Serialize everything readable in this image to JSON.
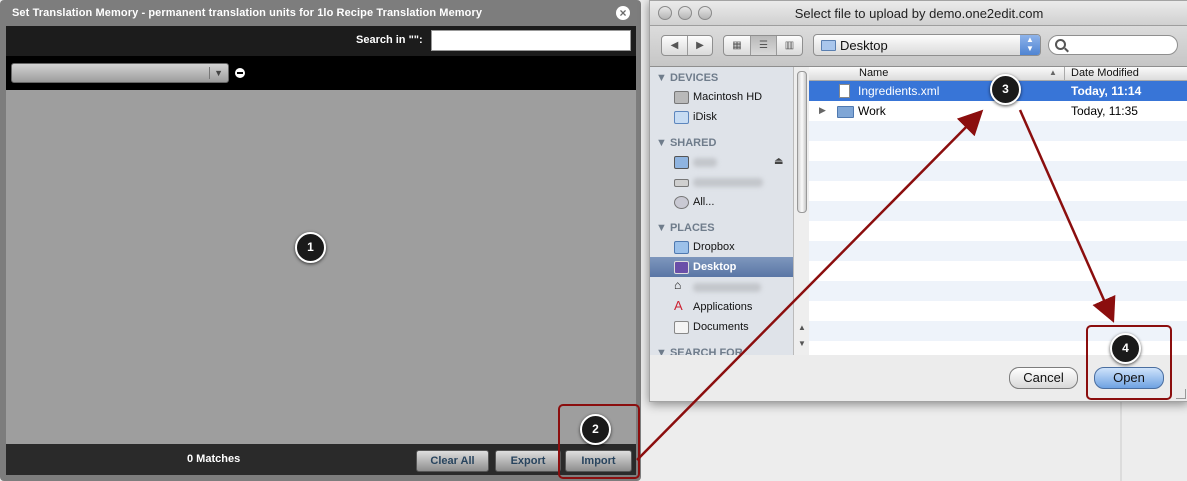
{
  "tm_dialog": {
    "title": "Set Translation Memory - permanent translation units for 1lo Recipe Translation Memory",
    "close_icon": "close-icon",
    "search_label": "Search in \"\":",
    "search_value": "",
    "filter_value": "",
    "matches_text": "0 Matches",
    "buttons": {
      "clear_all": "Clear All",
      "export": "Export",
      "import": "Import"
    }
  },
  "file_dialog": {
    "title": "Select file to upload by demo.one2edit.com",
    "location": "Desktop",
    "search_placeholder": "",
    "sidebar": {
      "devices_header": "DEVICES",
      "devices": [
        {
          "label": "Macintosh HD",
          "icon": "harddisk-icon"
        },
        {
          "label": "iDisk",
          "icon": "idisk-icon"
        }
      ],
      "shared_header": "SHARED",
      "shared": [
        {
          "label": "All...",
          "icon": "network-icon"
        }
      ],
      "places_header": "PLACES",
      "places": [
        {
          "label": "Dropbox",
          "icon": "dropbox-folder-icon"
        },
        {
          "label": "Desktop",
          "icon": "desktop-icon",
          "selected": true
        },
        {
          "label": "Applications",
          "icon": "applications-icon"
        },
        {
          "label": "Documents",
          "icon": "documents-icon"
        }
      ],
      "search_for_header": "SEARCH FOR"
    },
    "columns": {
      "name": "Name",
      "date_modified": "Date Modified"
    },
    "files": [
      {
        "name": "Ingredients.xml",
        "date": "Today, 11:14",
        "type": "file",
        "selected": true
      },
      {
        "name": "Work",
        "date": "Today, 11:35",
        "type": "folder",
        "selected": false
      }
    ],
    "buttons": {
      "cancel": "Cancel",
      "open": "Open"
    }
  },
  "annotations": {
    "step1": "1",
    "step2": "2",
    "step3": "3",
    "step4": "4"
  },
  "colors": {
    "annotation": "#8b0e0e",
    "selection": "#3875d7",
    "dialog_gray": "#9e9e9e"
  }
}
